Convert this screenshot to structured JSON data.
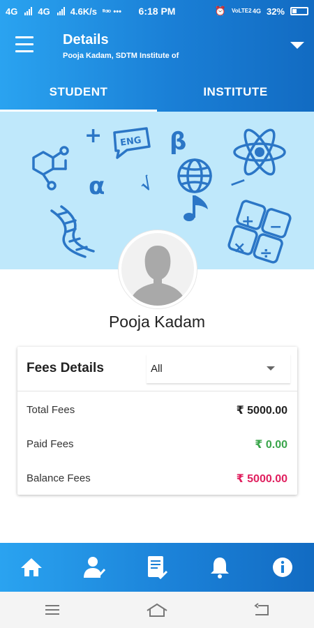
{
  "status_bar": {
    "network1": "4G",
    "network2": "4G",
    "speed": "4.6K/s",
    "extra": "ᶦᶦ⚮ •••",
    "time": "6:18 PM",
    "volte": "VoLTE2",
    "network3": "4G",
    "battery": "32%"
  },
  "header": {
    "title": "Details",
    "subtitle": "Pooja Kadam, SDTM Institute of"
  },
  "tabs": [
    {
      "label": "STUDENT",
      "active": true
    },
    {
      "label": "INSTITUTE",
      "active": false
    }
  ],
  "banner": {
    "texts": [
      "ENG",
      "+",
      "β",
      "α",
      "√",
      "—"
    ]
  },
  "profile": {
    "name": "Pooja Kadam"
  },
  "fees": {
    "title": "Fees Details",
    "filter_value": "All",
    "rows": [
      {
        "label": "Total Fees",
        "value": "₹ 5000.00",
        "color": "#222222"
      },
      {
        "label": "Paid Fees",
        "value": "₹ 0.00",
        "color": "#3aa54b"
      },
      {
        "label": "Balance Fees",
        "value": "₹ 5000.00",
        "color": "#e0205f"
      }
    ]
  },
  "bottom_nav": [
    {
      "icon": "home-icon"
    },
    {
      "icon": "profile-check-icon"
    },
    {
      "icon": "document-check-icon"
    },
    {
      "icon": "bell-icon"
    },
    {
      "icon": "info-icon"
    }
  ],
  "colors": {
    "brand_blue": "#1a7fd6",
    "banner_bg": "#bfe8fb",
    "banner_icon": "#2b76c6"
  }
}
